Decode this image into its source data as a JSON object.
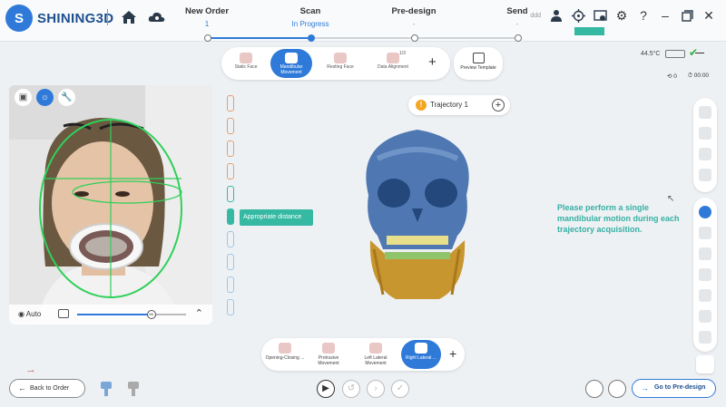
{
  "app": {
    "name": "SHINING3D"
  },
  "colors": {
    "accent": "#2f7ad9",
    "teal": "#35b9a3",
    "guide_green": "#2fd05a"
  },
  "steps": [
    {
      "title": "New Order",
      "sub": "1"
    },
    {
      "title": "Scan",
      "sub": "In Progress"
    },
    {
      "title": "Pre-design",
      "sub": "-"
    },
    {
      "title": "Send",
      "sub": "-"
    }
  ],
  "header": {
    "user_label": "ddd"
  },
  "modes": [
    {
      "label": "Static Face"
    },
    {
      "label": "Mandibular Movement"
    },
    {
      "label": "Resting Face"
    },
    {
      "label": "Data Alignment",
      "badge": "1/3"
    }
  ],
  "preview_template": "Preview Template",
  "device": {
    "temperature": "44.5°C"
  },
  "recording": {
    "count": "0",
    "time": "00:00"
  },
  "camera": {
    "auto_label": "Auto",
    "slider_value": "56",
    "slider_fraction": 0.68
  },
  "distance": {
    "label": "Appropriate distance"
  },
  "trajectory": {
    "badge": "!",
    "label": "Trajectory 1"
  },
  "instruction": "Please perform a single mandibular motion during each trajectory acquisition.",
  "motions": [
    {
      "label": "Opening-Closing ..."
    },
    {
      "label": "Protrusive Movement"
    },
    {
      "label": "Left Lateral Movement"
    },
    {
      "label": "Right Lateral ..."
    }
  ],
  "footer": {
    "back": "Back to Order",
    "next": "Go to Pre-design"
  }
}
